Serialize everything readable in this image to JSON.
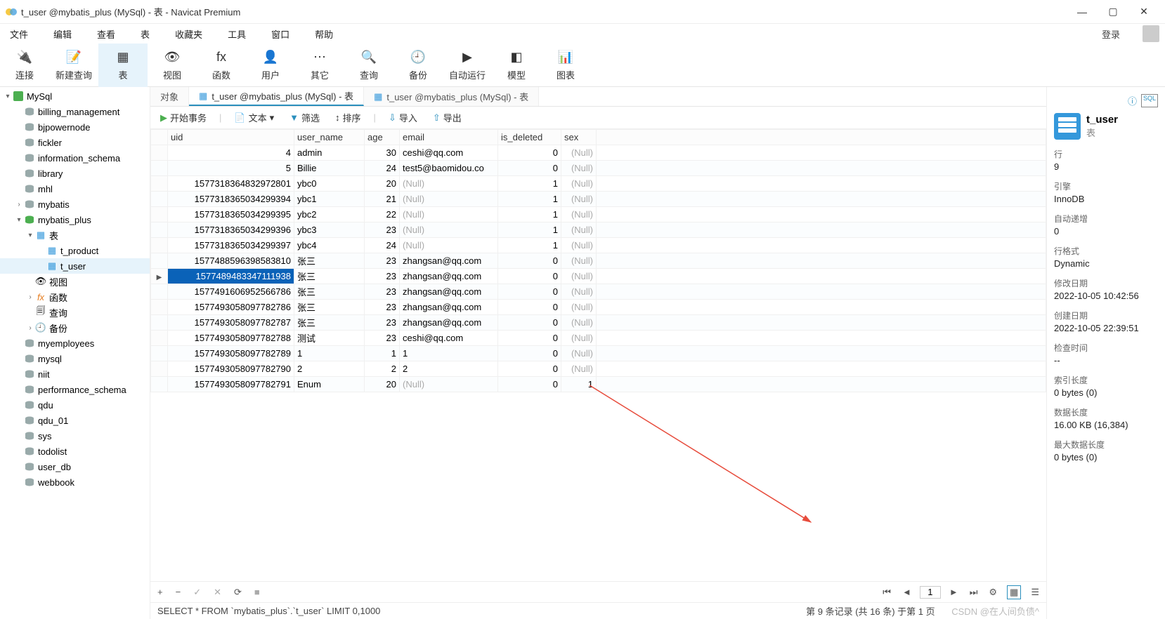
{
  "window": {
    "title": "t_user @mybatis_plus (MySql) - 表 - Navicat Premium"
  },
  "menu": [
    "文件",
    "编辑",
    "查看",
    "表",
    "收藏夹",
    "工具",
    "窗口",
    "帮助"
  ],
  "login_label": "登录",
  "toolbar": [
    {
      "label": "连接",
      "name": "connection"
    },
    {
      "label": "新建查询",
      "name": "new-query"
    },
    {
      "label": "表",
      "name": "table",
      "active": true
    },
    {
      "label": "视图",
      "name": "view"
    },
    {
      "label": "函数",
      "name": "function"
    },
    {
      "label": "用户",
      "name": "user"
    },
    {
      "label": "其它",
      "name": "other"
    },
    {
      "label": "查询",
      "name": "query"
    },
    {
      "label": "备份",
      "name": "backup"
    },
    {
      "label": "自动运行",
      "name": "automation"
    },
    {
      "label": "模型",
      "name": "model"
    },
    {
      "label": "图表",
      "name": "chart"
    }
  ],
  "sidebar": {
    "root": "MySql",
    "dbs": [
      "billing_management",
      "bjpowernode",
      "fickler",
      "information_schema",
      "library",
      "mhl",
      "mybatis"
    ],
    "open_db": "mybatis_plus",
    "open_db_children": {
      "tables_label": "表",
      "tables": [
        "t_product",
        "t_user"
      ],
      "selected_table": "t_user",
      "views_label": "视图",
      "functions_label": "函数",
      "queries_label": "查询",
      "backups_label": "备份"
    },
    "dbs_after": [
      "myemployees",
      "mysql",
      "niit",
      "performance_schema",
      "qdu",
      "qdu_01",
      "sys",
      "todolist",
      "user_db",
      "webbook"
    ]
  },
  "tabs": [
    {
      "label": "对象",
      "active": false
    },
    {
      "label": "t_user @mybatis_plus (MySql) - 表",
      "active": true
    },
    {
      "label": "t_user @mybatis_plus (MySql) - 表",
      "active": false
    }
  ],
  "subtoolbar": {
    "begin_tx": "开始事务",
    "text": "文本",
    "filter": "筛选",
    "sort": "排序",
    "import": "导入",
    "export": "导出"
  },
  "columns": [
    "uid",
    "user_name",
    "age",
    "email",
    "is_deleted",
    "sex"
  ],
  "null_text": "(Null)",
  "rows": [
    {
      "uid": "4",
      "user_name": "admin",
      "age": "30",
      "email": "ceshi@qq.com",
      "is_deleted": "0",
      "sex": null
    },
    {
      "uid": "5",
      "user_name": "Billie",
      "age": "24",
      "email": "test5@baomidou.co",
      "is_deleted": "0",
      "sex": null
    },
    {
      "uid": "1577318364832972801",
      "user_name": "ybc0",
      "age": "20",
      "email": null,
      "is_deleted": "1",
      "sex": null
    },
    {
      "uid": "1577318365034299394",
      "user_name": "ybc1",
      "age": "21",
      "email": null,
      "is_deleted": "1",
      "sex": null
    },
    {
      "uid": "1577318365034299395",
      "user_name": "ybc2",
      "age": "22",
      "email": null,
      "is_deleted": "1",
      "sex": null
    },
    {
      "uid": "1577318365034299396",
      "user_name": "ybc3",
      "age": "23",
      "email": null,
      "is_deleted": "1",
      "sex": null
    },
    {
      "uid": "1577318365034299397",
      "user_name": "ybc4",
      "age": "24",
      "email": null,
      "is_deleted": "1",
      "sex": null
    },
    {
      "uid": "1577488596398583810",
      "user_name": "张三",
      "age": "23",
      "email": "zhangsan@qq.com",
      "is_deleted": "0",
      "sex": null
    },
    {
      "uid": "1577489483347111938",
      "user_name": "张三",
      "age": "23",
      "email": "zhangsan@qq.com",
      "is_deleted": "0",
      "sex": null,
      "selected": true
    },
    {
      "uid": "1577491606952566786",
      "user_name": "张三",
      "age": "23",
      "email": "zhangsan@qq.com",
      "is_deleted": "0",
      "sex": null
    },
    {
      "uid": "1577493058097782786",
      "user_name": "张三",
      "age": "23",
      "email": "zhangsan@qq.com",
      "is_deleted": "0",
      "sex": null
    },
    {
      "uid": "1577493058097782787",
      "user_name": "张三",
      "age": "23",
      "email": "zhangsan@qq.com",
      "is_deleted": "0",
      "sex": null
    },
    {
      "uid": "1577493058097782788",
      "user_name": "测试",
      "age": "23",
      "email": "ceshi@qq.com",
      "is_deleted": "0",
      "sex": null
    },
    {
      "uid": "1577493058097782789",
      "user_name": "1",
      "age": "1",
      "email": "1",
      "is_deleted": "0",
      "sex": null
    },
    {
      "uid": "1577493058097782790",
      "user_name": "2",
      "age": "2",
      "email": "2",
      "is_deleted": "0",
      "sex": null
    },
    {
      "uid": "1577493058097782791",
      "user_name": "Enum",
      "age": "20",
      "email": null,
      "is_deleted": "0",
      "sex": "1"
    }
  ],
  "bottombar": {
    "add": "+",
    "remove": "−",
    "check": "✓",
    "cancel": "✕",
    "refresh": "⟳",
    "stop": "■",
    "page": "1",
    "status": "第 9 条记录 (共 16 条) 于第 1 页"
  },
  "sql": "SELECT * FROM `mybatis_plus`.`t_user` LIMIT 0,1000",
  "watermark": "CSDN @在人间负债^",
  "rightpanel": {
    "title": "t_user",
    "subtitle": "表",
    "meta": [
      {
        "lbl": "行",
        "val": "9"
      },
      {
        "lbl": "引擎",
        "val": "InnoDB"
      },
      {
        "lbl": "自动递增",
        "val": "0"
      },
      {
        "lbl": "行格式",
        "val": "Dynamic"
      },
      {
        "lbl": "修改日期",
        "val": "2022-10-05 10:42:56"
      },
      {
        "lbl": "创建日期",
        "val": "2022-10-05 22:39:51"
      },
      {
        "lbl": "检查时间",
        "val": "--"
      },
      {
        "lbl": "索引长度",
        "val": "0 bytes (0)"
      },
      {
        "lbl": "数据长度",
        "val": "16.00 KB (16,384)"
      },
      {
        "lbl": "最大数据长度",
        "val": "0 bytes (0)"
      }
    ]
  }
}
